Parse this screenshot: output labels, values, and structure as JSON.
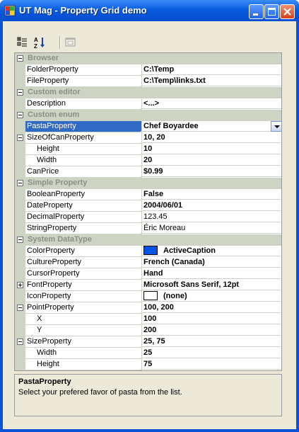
{
  "window": {
    "title": "UT Mag - Property Grid demo"
  },
  "colors": {
    "category_bg": "#ced4c3",
    "selection": "#316ac5",
    "active_caption": "#0054e3"
  },
  "toolbar": {
    "buttons": [
      "categorized-icon",
      "alphabetical-icon",
      "property-pages-icon"
    ]
  },
  "grid": {
    "browser": {
      "label": "Browser",
      "folder_name": "FolderProperty",
      "folder_value": "C:\\Temp",
      "file_name": "FileProperty",
      "file_value": "C:\\Temp\\links.txt"
    },
    "custom_editor": {
      "label": "Custom editor",
      "description_name": "Description",
      "description_value": "<...>"
    },
    "custom_enum": {
      "label": "Custom enum",
      "pasta_name": "PastaProperty",
      "pasta_value": "Chef Boyardee",
      "sizecan_name": "SizeOfCanProperty",
      "sizecan_value": "10, 20",
      "height_name": "Height",
      "height_value": "10",
      "width_name": "Width",
      "width_value": "20",
      "canprice_name": "CanPrice",
      "canprice_value": "$0.99"
    },
    "simple": {
      "label": "Simple Property",
      "bool_name": "BooleanProperty",
      "bool_value": "False",
      "date_name": "DateProperty",
      "date_value": "2004/06/01",
      "decimal_name": "DecimalProperty",
      "decimal_value": "123.45",
      "string_name": "StringProperty",
      "string_value": "Éric Moreau"
    },
    "system": {
      "label": "System DataType",
      "color_name": "ColorProperty",
      "color_value": "ActiveCaption",
      "culture_name": "CultureProperty",
      "culture_value": "French (Canada)",
      "cursor_name": "CursorProperty",
      "cursor_value": "Hand",
      "font_name": "FontProperty",
      "font_value": "Microsoft Sans Serif, 12pt",
      "icon_name": "IconProperty",
      "icon_value": "(none)",
      "point_name": "PointProperty",
      "point_value": "100, 200",
      "x_name": "X",
      "x_value": "100",
      "y_name": "Y",
      "y_value": "200",
      "size_name": "SizeProperty",
      "size_value": "25, 75",
      "swidth_name": "Width",
      "swidth_value": "25",
      "sheight_name": "Height",
      "sheight_value": "75"
    }
  },
  "description": {
    "title": "PastaProperty",
    "text": "Select your prefered favor of pasta from the list."
  }
}
